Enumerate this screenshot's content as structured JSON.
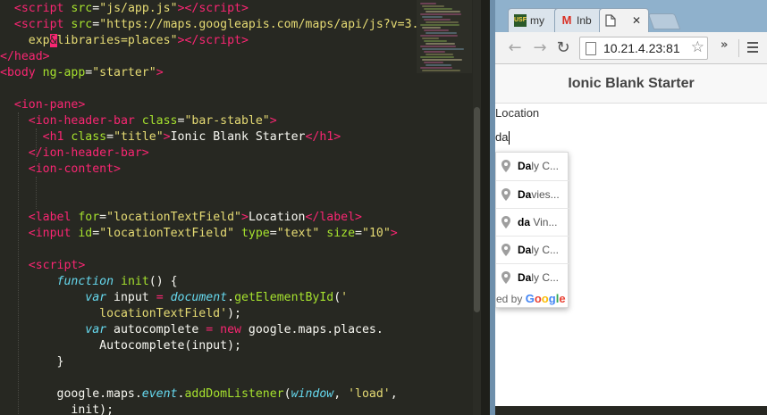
{
  "editor": {
    "lines": [
      [
        [
          "tag",
          "  <script"
        ],
        [
          "attr",
          " src"
        ],
        [
          "plain",
          "="
        ],
        [
          "str",
          "\"js/app.js\""
        ],
        [
          "tag",
          ">"
        ],
        [
          "tag",
          "</script"
        ],
        [
          "tag",
          ">"
        ]
      ],
      [
        [
          "tag",
          "  <script"
        ],
        [
          "attr",
          " src"
        ],
        [
          "plain",
          "="
        ],
        [
          "str",
          "\"https://maps.googleapis.com/maps/api/js?v=3."
        ]
      ],
      [
        [
          "str",
          "    exp"
        ],
        [
          "hl",
          "&"
        ],
        [
          "str",
          "libraries=places\""
        ],
        [
          "tag",
          ">"
        ],
        [
          "tag",
          "</script"
        ],
        [
          "tag",
          ">"
        ]
      ],
      [
        [
          "tag",
          "</head"
        ],
        [
          "tag",
          ">"
        ]
      ],
      [
        [
          "tag",
          "<body"
        ],
        [
          "attr",
          " ng-app"
        ],
        [
          "plain",
          "="
        ],
        [
          "str",
          "\"starter\""
        ],
        [
          "tag",
          ">"
        ]
      ],
      [
        [
          "plain",
          ""
        ]
      ],
      [
        [
          "tag",
          "  <ion-pane"
        ],
        [
          "tag",
          ">"
        ]
      ],
      [
        [
          "tag",
          "    <ion-header-bar"
        ],
        [
          "attr",
          " class"
        ],
        [
          "plain",
          "="
        ],
        [
          "str",
          "\"bar-stable\""
        ],
        [
          "tag",
          ">"
        ]
      ],
      [
        [
          "tag",
          "      <h1"
        ],
        [
          "attr",
          " class"
        ],
        [
          "plain",
          "="
        ],
        [
          "str",
          "\"title\""
        ],
        [
          "tag",
          ">"
        ],
        [
          "plain",
          "Ionic Blank Starter"
        ],
        [
          "tag",
          "</h1"
        ],
        [
          "tag",
          ">"
        ]
      ],
      [
        [
          "tag",
          "    </ion-header-bar"
        ],
        [
          "tag",
          ">"
        ]
      ],
      [
        [
          "tag",
          "    <ion-content"
        ],
        [
          "tag",
          ">"
        ]
      ],
      [
        [
          "plain",
          ""
        ]
      ],
      [
        [
          "plain",
          ""
        ]
      ],
      [
        [
          "tag",
          "    <label"
        ],
        [
          "attr",
          " for"
        ],
        [
          "plain",
          "="
        ],
        [
          "str",
          "\"locationTextField\""
        ],
        [
          "tag",
          ">"
        ],
        [
          "plain",
          "Location"
        ],
        [
          "tag",
          "</label"
        ],
        [
          "tag",
          ">"
        ]
      ],
      [
        [
          "tag",
          "    <input"
        ],
        [
          "attr",
          " id"
        ],
        [
          "plain",
          "="
        ],
        [
          "str",
          "\"locationTextField\""
        ],
        [
          "attr",
          " type"
        ],
        [
          "plain",
          "="
        ],
        [
          "str",
          "\"text\""
        ],
        [
          "attr",
          " size"
        ],
        [
          "plain",
          "="
        ],
        [
          "str",
          "\"10\""
        ],
        [
          "tag",
          ">"
        ]
      ],
      [
        [
          "plain",
          ""
        ]
      ],
      [
        [
          "tag",
          "    <script"
        ],
        [
          "tag",
          ">"
        ]
      ],
      [
        [
          "plain",
          "        "
        ],
        [
          "kw",
          "function"
        ],
        [
          "fn",
          " init"
        ],
        [
          "plain",
          "() {"
        ]
      ],
      [
        [
          "plain",
          "            "
        ],
        [
          "kw",
          "var"
        ],
        [
          "plain",
          " input "
        ],
        [
          "op",
          "="
        ],
        [
          "kw",
          " document"
        ],
        [
          "plain",
          "."
        ],
        [
          "fn",
          "getElementById"
        ],
        [
          "plain",
          "("
        ],
        [
          "str",
          "'"
        ]
      ],
      [
        [
          "str",
          "              locationTextField'"
        ],
        [
          "plain",
          ");"
        ]
      ],
      [
        [
          "plain",
          "            "
        ],
        [
          "kw",
          "var"
        ],
        [
          "plain",
          " autocomplete "
        ],
        [
          "op",
          "="
        ],
        [
          "op",
          " new"
        ],
        [
          "plain",
          " google.maps.places."
        ]
      ],
      [
        [
          "plain",
          "              Autocomplete(input);"
        ]
      ],
      [
        [
          "plain",
          "        }"
        ]
      ],
      [
        [
          "plain",
          ""
        ]
      ],
      [
        [
          "plain",
          "        google.maps."
        ],
        [
          "kw",
          "event"
        ],
        [
          "plain",
          "."
        ],
        [
          "fn",
          "addDomListener"
        ],
        [
          "plain",
          "("
        ],
        [
          "kw",
          "window"
        ],
        [
          "plain",
          ", "
        ],
        [
          "str",
          "'load'"
        ],
        [
          "plain",
          ","
        ]
      ],
      [
        [
          "plain",
          "          init);"
        ]
      ]
    ]
  },
  "browser": {
    "tabs": [
      {
        "label": "my",
        "icon": "usf-favicon",
        "icon_text": "USF"
      },
      {
        "label": "Inb",
        "icon": "gmail-icon",
        "icon_text": "M"
      },
      {
        "label": "",
        "icon": "page-icon",
        "close": "✕"
      }
    ],
    "back_label": "←",
    "forward_label": "→",
    "reload_label": "↻",
    "url": "10.21.4.23:81",
    "star": "☆",
    "overflow": "»",
    "page": {
      "title": "Ionic Blank Starter",
      "location_label": "Location",
      "location_value": "da"
    },
    "autocomplete": {
      "items": [
        {
          "match": "Da",
          "rest": "ly C..."
        },
        {
          "match": "Da",
          "rest": "vies..."
        },
        {
          "match": "da",
          "rest": " Vin..."
        },
        {
          "match": "Da",
          "rest": "ly C..."
        },
        {
          "match": "Da",
          "rest": "ly C..."
        }
      ],
      "powered_by": "ed by ",
      "google_letters": [
        "G",
        "o",
        "o",
        "g",
        "l",
        "e"
      ],
      "google_colors": [
        "#4285f4",
        "#ea4335",
        "#fbbc05",
        "#4285f4",
        "#34a853",
        "#ea4335"
      ]
    }
  },
  "colors": {
    "editor_bg": "#272822",
    "tag": "#f92672",
    "attr": "#a6e22e",
    "string": "#e6db74",
    "keyword": "#66d9ef",
    "browser_frame": "#87aac6"
  }
}
